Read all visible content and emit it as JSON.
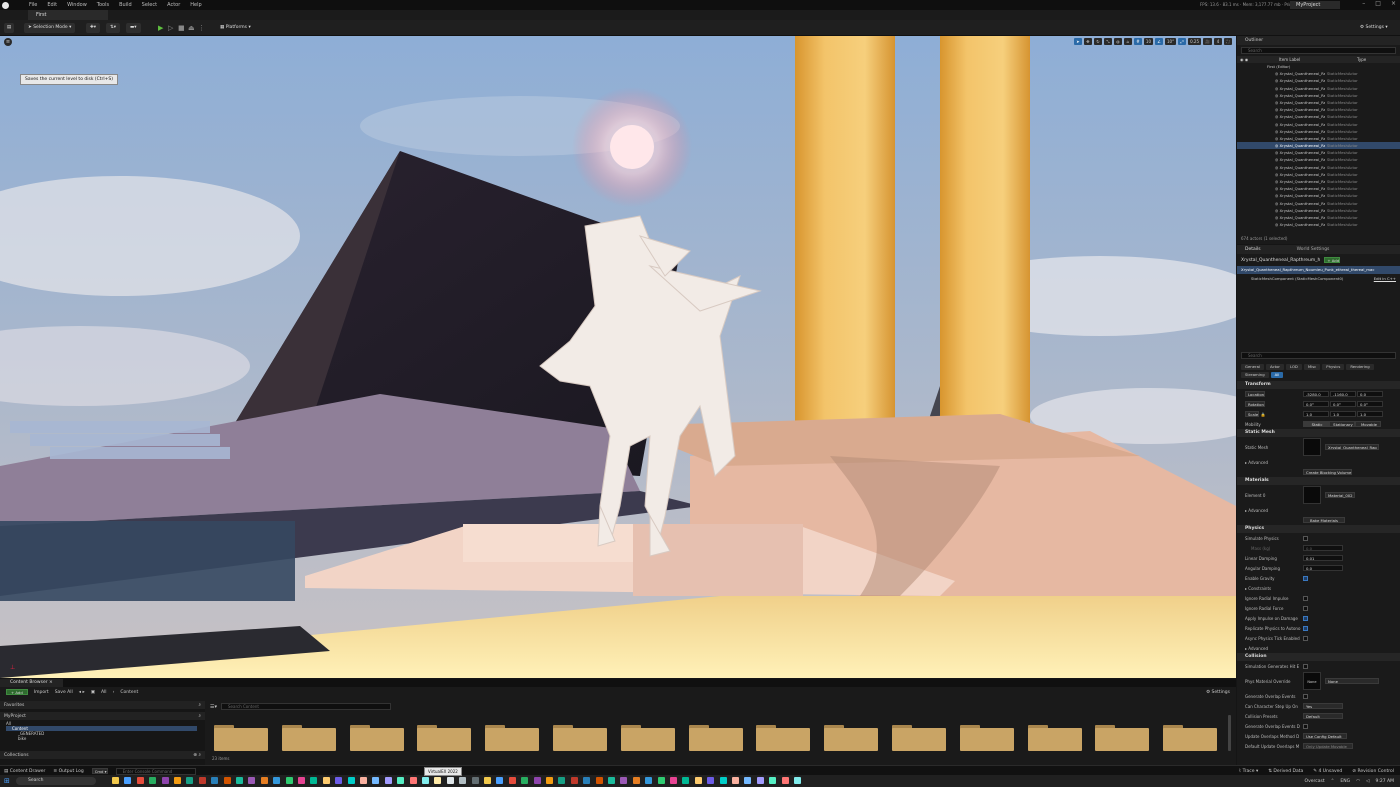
{
  "titlebar": {
    "menu": [
      "File",
      "Edit",
      "Window",
      "Tools",
      "Build",
      "Select",
      "Actor",
      "Help"
    ],
    "stats": "FPS: 13.6 · 83.1 ms · Mem: 3,177.77 mb · Prim: 164,804 · Draws: 4",
    "project": "MyProject"
  },
  "level_tab": "First",
  "toolbar": {
    "selection_mode": "Selection Mode",
    "platforms": "Platforms",
    "settings": "Settings"
  },
  "tooltip": "Saves the current level to disk (Ctrl+S)",
  "viewport": {
    "tools": [
      "10",
      "10°",
      "0.25",
      "4"
    ]
  },
  "outliner": {
    "tab": "Outliner",
    "search_placeholder": "Search",
    "col_label": "Item Label",
    "col_type": "Type",
    "root": "First (Editor)",
    "row_name": "Xrystal_Quantheneal_Rapthreum_h",
    "row_type": "StaticMeshActor",
    "selected_index": 10,
    "actor_count": "674 actors (1 selected)"
  },
  "details": {
    "tab_details": "Details",
    "tab_world": "World Settings",
    "actor_name": "Xrystal_Quantheneal_Rapthreum_h",
    "add_label": "+ Add",
    "component_root": "Xrystal_Quantheneal_Rapthreum_Noumieu_Punk_ethreal_thereal_mac",
    "component_child": "StaticMeshComponent (StaticMeshComponent0)",
    "edit_in": "Edit in C++",
    "search_placeholder": "Search",
    "filters": [
      "General",
      "Actor",
      "LOD",
      "Misc",
      "Physics",
      "Rendering",
      "Streaming",
      "All"
    ],
    "transform": {
      "title": "Transform",
      "location_label": "Location",
      "rotation_label": "Rotation",
      "scale_label": "Scale",
      "location": [
        "-5280.0",
        "-1160.0",
        "0.0"
      ],
      "rotation": [
        "0.0°",
        "0.0°",
        "0.0°"
      ],
      "scale": [
        "1.0",
        "1.0",
        "1.0"
      ],
      "mobility_label": "Mobility",
      "mobility_options": [
        "Static",
        "Stationary",
        "Movable"
      ]
    },
    "static_mesh": {
      "title": "Static Mesh",
      "label": "Static Mesh",
      "value": "Xrystal_Quantheneal_Rap",
      "advanced": "Advanced",
      "blocking_volume": "Create Blocking Volume"
    },
    "materials": {
      "title": "Materials",
      "element_label": "Element 0",
      "value": "Material_002",
      "advanced": "Advanced",
      "bake": "Bake Materials"
    },
    "physics": {
      "title": "Physics",
      "simulate": "Simulate Physics",
      "mass": "Mass (kg)",
      "mass_value": "0.0",
      "linear_damping": "Linear Damping",
      "linear_damping_value": "0.01",
      "angular_damping": "Angular Damping",
      "angular_damping_value": "0.0",
      "enable_gravity": "Enable Gravity",
      "constraints": "Constraints",
      "ignore_radial_impulse": "Ignore Radial Impulse",
      "ignore_radial_force": "Ignore Radial Force",
      "apply_impulse": "Apply Impulse on Damage",
      "replicate": "Replicate Physics to Autono",
      "async": "Async Physics Tick Enabled",
      "advanced": "Advanced"
    },
    "collision": {
      "title": "Collision",
      "sim_hit": "Simulation Generates Hit E",
      "phys_override": "Phys Material Override",
      "phys_value": "None",
      "none_thumb": "None",
      "overlap": "Generate Overlap Events",
      "step_up": "Can Character Step Up On",
      "step_up_value": "Yes",
      "presets": "Collision Presets",
      "presets_value": "Default",
      "overlap_during": "Generate Overlap Events D",
      "update_method": "Update Overlaps Method D",
      "update_method_value": "Use Config Default",
      "default_update": "Default Update Overlaps M",
      "default_update_value": "Only Update Movable"
    }
  },
  "content_browser": {
    "tab": "Content Browser",
    "add": "+ Add",
    "import": "Import",
    "save_all": "Save All",
    "path": [
      "All",
      "Content"
    ],
    "settings": "Settings",
    "favorites": "Favorites",
    "project": "MyProject",
    "tree": [
      "All",
      "Content",
      "_GENERATED",
      "bike"
    ],
    "collections": "Collections",
    "search_placeholder": "Search Content",
    "items_count": "23 items",
    "folder_count": 15
  },
  "statusbar": {
    "content_drawer": "Content Drawer",
    "output_log": "Output Log",
    "cmd": "Cmd",
    "cmd_placeholder": "Enter Console Command",
    "trace": "Trace",
    "derived_data": "Derived Data",
    "unsaved": "4 Unsaved",
    "revision": "Revision Control"
  },
  "taskbar": {
    "search": "Search",
    "tooltip": "VirtualEX 2022",
    "weather": "Overcast",
    "lang": "ENG",
    "clock": "9:27 AM"
  },
  "colors": {
    "accent": "#2a6aa8",
    "selection": "#31496a",
    "folder": "#c9a465",
    "play": "#5fbf3f"
  }
}
